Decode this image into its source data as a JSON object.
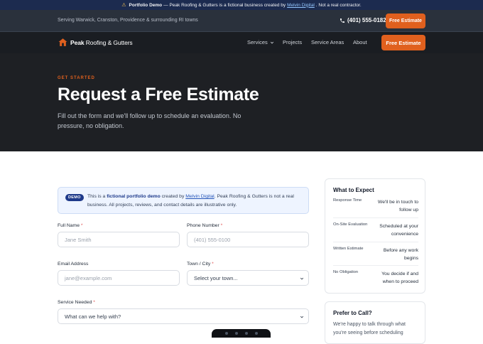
{
  "demo_banner": {
    "icon": "warning-icon",
    "prefix": "Portfolio Demo",
    "text_before_link": " — Peak Roofing & Gutters is a fictional business created by ",
    "link": "Melvin Digital",
    "text_after_link": ". Not a real contractor."
  },
  "utility_bar": {
    "serving": "Serving Warwick, Cranston, Providence & surrounding RI towns",
    "phone": "(401) 555-0182",
    "cta": "Free Estimate"
  },
  "nav": {
    "brand_bold": "Peak",
    "brand_light": " Roofing & Gutters",
    "links": [
      "Services",
      "Projects",
      "Service Areas",
      "About"
    ],
    "cta": "Free Estimate"
  },
  "hero": {
    "eyebrow": "GET STARTED",
    "title": "Request a Free Estimate",
    "subtitle": "Fill out the form and we'll follow up to schedule an evaluation. No pressure, no obligation."
  },
  "notice": {
    "badge": "DEMO",
    "text_1": "This is a ",
    "bold": "fictional portfolio demo",
    "text_2": " created by ",
    "link": "Melvin Digital",
    "text_3": ". Peak Roofing & Gutters is not a real business. All projects, reviews, and contact details are illustrative only."
  },
  "form": {
    "full_name": {
      "label": "Full Name",
      "required": "*",
      "placeholder": "Jane Smith"
    },
    "phone": {
      "label": "Phone Number",
      "required": "*",
      "placeholder": "(401) 555-0100"
    },
    "email": {
      "label": "Email Address",
      "placeholder": "jane@example.com"
    },
    "town": {
      "label": "Town / City",
      "required": "*",
      "value": "Select your town..."
    },
    "service": {
      "label": "Service Needed",
      "required": "*",
      "value": "What can we help with?"
    }
  },
  "expect": {
    "title": "What to Expect",
    "rows": [
      {
        "k": "Response Time",
        "v": "We'll be in touch to follow up"
      },
      {
        "k": "On-Site Evaluation",
        "v": "Scheduled at your convenience"
      },
      {
        "k": "Written Estimate",
        "v": "Before any work begins"
      },
      {
        "k": "No Obligation",
        "v": "You decide if and when to proceed"
      }
    ]
  },
  "call_card": {
    "title": "Prefer to Call?",
    "text": "We're happy to talk through what you're seeing before scheduling"
  },
  "colors": {
    "accent": "#e0601e",
    "banner": "#1c2b4f",
    "hero_bg": "#1e2024"
  }
}
